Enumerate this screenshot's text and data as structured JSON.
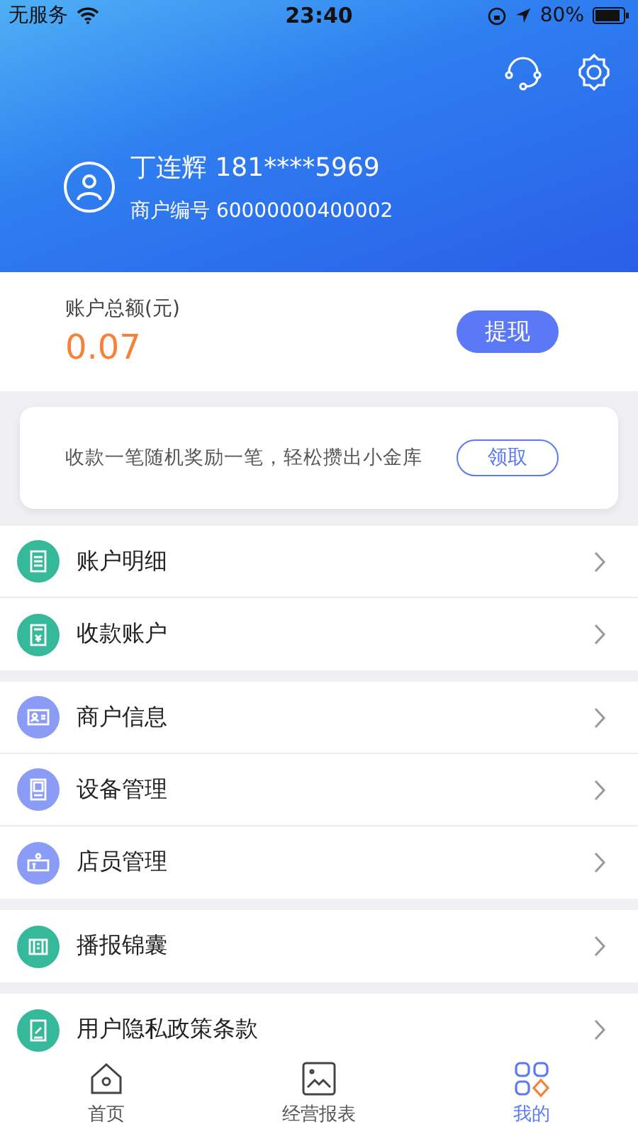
{
  "status_bar": {
    "carrier": "无服务",
    "time": "23:40",
    "battery": "80%"
  },
  "profile": {
    "name": "丁连辉 181****5969",
    "merchant_no": "商户编号 60000000400002"
  },
  "balance": {
    "label": "账户总额(元)",
    "amount": "0.07",
    "button": "提现"
  },
  "promo": {
    "text": "收款一笔随机奖励一笔，轻松攒出小金库",
    "button": "领取"
  },
  "menu_groups": [
    {
      "items": [
        {
          "label": "账户明细",
          "color": "#36b99a"
        },
        {
          "label": "收款账户",
          "color": "#36b99a"
        }
      ]
    },
    {
      "items": [
        {
          "label": "商户信息",
          "color": "#8b9cf7"
        },
        {
          "label": "设备管理",
          "color": "#8b9cf7"
        },
        {
          "label": "店员管理",
          "color": "#8b9cf7"
        }
      ]
    },
    {
      "items": [
        {
          "label": "播报锦囊",
          "color": "#36b99a"
        }
      ]
    },
    {
      "items": [
        {
          "label": "用户隐私政策条款",
          "color": "#36b99a"
        }
      ]
    }
  ],
  "tabs": [
    {
      "label": "首页",
      "selected": false
    },
    {
      "label": "经营报表",
      "selected": false
    },
    {
      "label": "我的",
      "selected": true
    }
  ]
}
